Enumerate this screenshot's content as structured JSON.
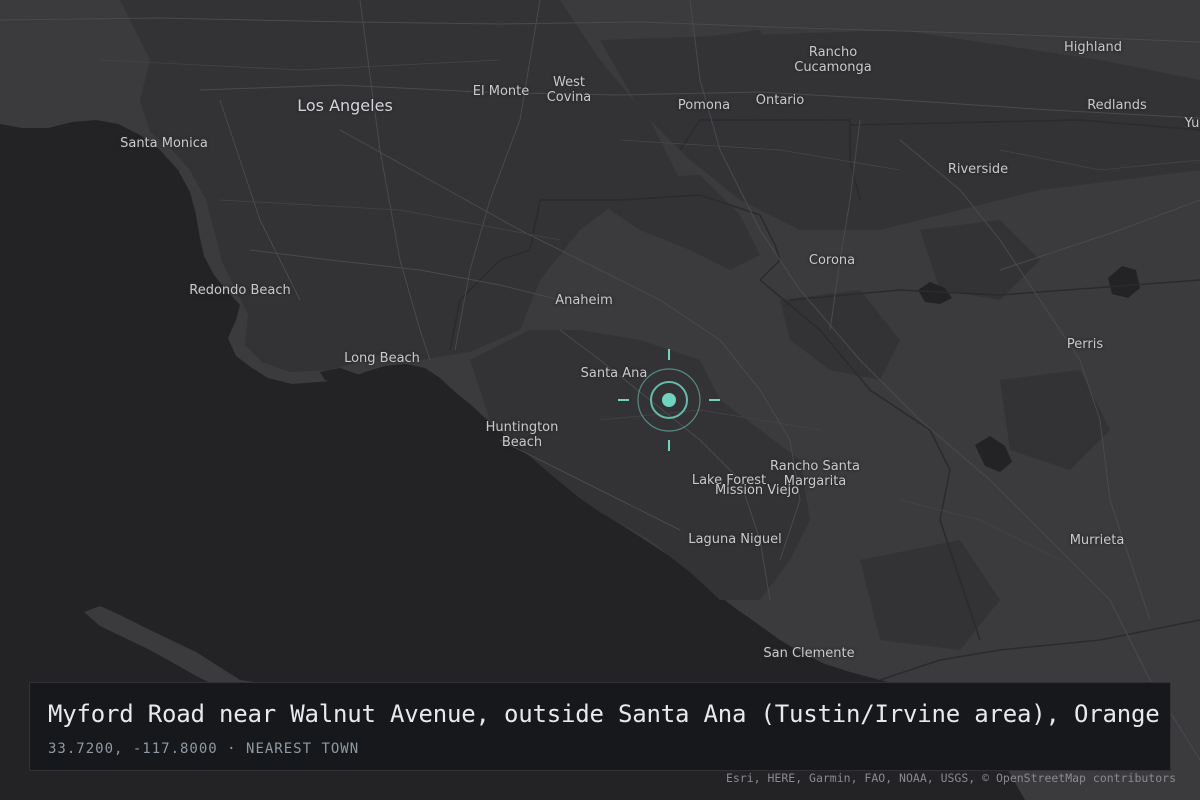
{
  "map": {
    "basemap": "dark-gray-canvas",
    "colors": {
      "water": "#232326",
      "land": "#3b3b3e",
      "urban": "#333336",
      "roads": "#4a4a4e",
      "boundary": "#2b2b2e",
      "marker_accent": "#6fd3bd"
    },
    "labels": [
      {
        "id": "los-angeles",
        "text": "Los Angeles",
        "major": true
      },
      {
        "id": "santa-monica",
        "text": "Santa Monica"
      },
      {
        "id": "el-monte",
        "text": "El Monte"
      },
      {
        "id": "west-covina",
        "text": "West\nCovina"
      },
      {
        "id": "pomona",
        "text": "Pomona"
      },
      {
        "id": "rancho-cucamonga",
        "text": "Rancho\nCucamonga"
      },
      {
        "id": "ontario",
        "text": "Ontario"
      },
      {
        "id": "highland",
        "text": "Highland"
      },
      {
        "id": "redlands",
        "text": "Redlands"
      },
      {
        "id": "yu",
        "text": "Yu"
      },
      {
        "id": "riverside",
        "text": "Riverside"
      },
      {
        "id": "redondo-beach",
        "text": "Redondo Beach"
      },
      {
        "id": "corona",
        "text": "Corona"
      },
      {
        "id": "anaheim",
        "text": "Anaheim"
      },
      {
        "id": "long-beach",
        "text": "Long Beach"
      },
      {
        "id": "perris",
        "text": "Perris"
      },
      {
        "id": "santa-ana",
        "text": "Santa Ana"
      },
      {
        "id": "huntington-beach",
        "text": "Huntington\nBeach"
      },
      {
        "id": "rancho-santa-margarita",
        "text": "Rancho Santa\nMargarita"
      },
      {
        "id": "lake-forest",
        "text": "Lake Forest"
      },
      {
        "id": "mission-viejo",
        "text": "Mission Viejo"
      },
      {
        "id": "laguna-niguel",
        "text": "Laguna Niguel"
      },
      {
        "id": "murrieta",
        "text": "Murrieta"
      },
      {
        "id": "san-clemente",
        "text": "San Clemente"
      }
    ],
    "marker": {
      "name": "location-reticle-icon",
      "lat": 33.72,
      "lon": -117.8
    }
  },
  "info": {
    "title": "Myford Road near Walnut Avenue, outside Santa Ana (Tustin/Irvine area), Orange County",
    "coordinates": "33.7200, -117.8000",
    "separator": " · ",
    "tag": "NEAREST TOWN"
  },
  "attribution": "Esri, HERE, Garmin, FAO, NOAA, USGS, © OpenStreetMap contributors"
}
